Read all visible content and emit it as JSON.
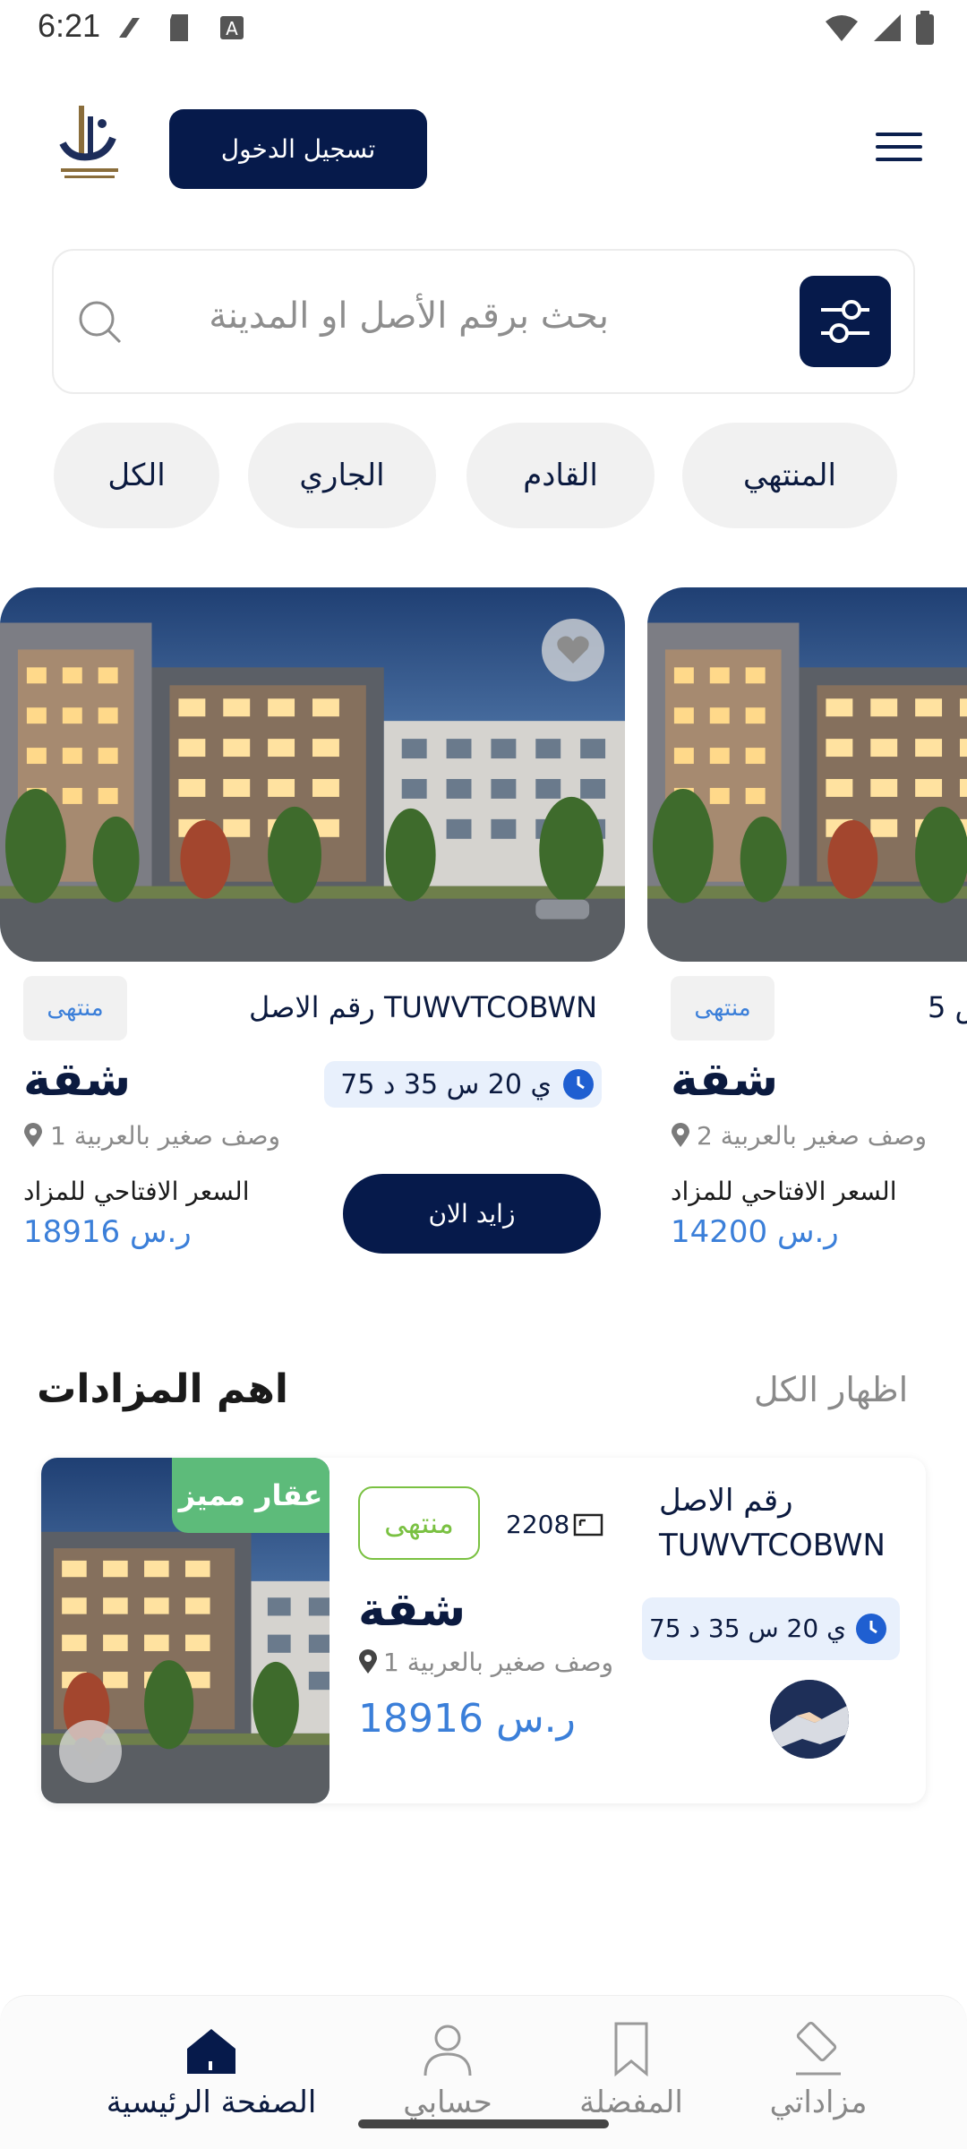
{
  "status_bar": {
    "time": "6:21"
  },
  "header": {
    "login_label": "تسجيل الدخول"
  },
  "search": {
    "placeholder": "بحث برقم الأصل او المدينة"
  },
  "filters": [
    {
      "label": "المنتهي"
    },
    {
      "label": "القادم"
    },
    {
      "label": "الجاري"
    },
    {
      "label": "الكل"
    }
  ],
  "cards": [
    {
      "asset_label": "رقم الاصل TUWVTCOBWN",
      "status": "منتهى",
      "timer": "ي 20 س 35 د 75",
      "type": "شقة",
      "location": "وصف صغير بالعربية 1",
      "price_label": "السعر الافتاحي للمزاد",
      "price": "ر.س 18916",
      "bid_label": "زايد الان"
    },
    {
      "asset_label": "س 5",
      "status": "منتهى",
      "type": "شقة",
      "location": "وصف صغير بالعربية 2",
      "price_label": "السعر الافتاحي للمزاد",
      "price": "ر.س 14200"
    }
  ],
  "top_auctions": {
    "title": "اهم المزادات",
    "show_all": "اظهار الكل",
    "item": {
      "featured": "عقار مميز",
      "asset_label": "رقم الاصل",
      "asset_code": "TUWVTCOBWN",
      "area": "2208",
      "status": "منتهى",
      "timer": "ي 20 س 35 د 75",
      "type": "شقة",
      "location": "وصف صغير بالعربية 1",
      "price": "ر.س 18916"
    }
  },
  "bottom_nav": [
    {
      "label": "مزاداتي",
      "icon": "gavel-icon"
    },
    {
      "label": "المفضلة",
      "icon": "bookmark-icon"
    },
    {
      "label": "حسابي",
      "icon": "user-icon"
    },
    {
      "label": "الصفحة الرئيسية",
      "icon": "home-icon",
      "active": true
    }
  ],
  "colors": {
    "primary": "#061a4b",
    "accent_blue": "#3b7fd9",
    "featured_green": "#5dbb7a",
    "status_green": "#7ac142"
  }
}
